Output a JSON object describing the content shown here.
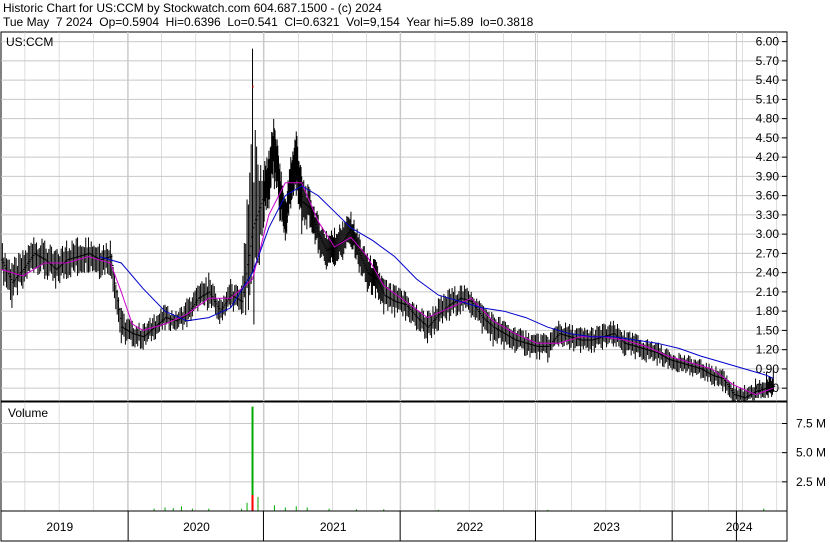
{
  "header": {
    "line1": "Historic Chart for US:CCM by Stockwatch.com 604.687.1500 - (c) 2024",
    "line2": "Tue May  7 2024  Op=0.5904  Hi=0.6396  Lo=0.541  Cl=0.6321  Vol=9,154  Year hi=5.89  lo=0.3818"
  },
  "colors": {
    "price": "#000000",
    "ma_short": "#cc00cc",
    "ma_long": "#0000cc",
    "volume": "#00aa00",
    "volume_spike": "#ff0000",
    "grid": "#c8c8c8",
    "close_marker": "#ff0000"
  },
  "chart_data": [
    {
      "type": "line",
      "panel": "price",
      "label": "US:CCM",
      "ylim": [
        0.4,
        6.15
      ],
      "yticks": [
        "6.00",
        "5.70",
        "5.40",
        "5.10",
        "4.80",
        "4.50",
        "4.20",
        "3.90",
        "3.60",
        "3.30",
        "3.00",
        "2.70",
        "2.40",
        "2.10",
        "1.80",
        "1.50",
        "1.20",
        "0.90",
        "0.60"
      ],
      "xlim": [
        2018.7,
        2024.45
      ],
      "grid": true,
      "series": [
        {
          "style": "hlc-bars",
          "x": [
            2018.7,
            2018.78,
            2018.86,
            2018.94,
            2019.02,
            2019.1,
            2019.18,
            2019.26,
            2019.34,
            2019.42,
            2019.5,
            2019.58,
            2019.66,
            2019.74,
            2019.82,
            2019.9,
            2019.98,
            2020.06,
            2020.14,
            2020.22,
            2020.3,
            2020.38,
            2020.46,
            2020.54,
            2020.62,
            2020.66,
            2020.7,
            2020.74,
            2020.78,
            2020.82,
            2020.86,
            2020.9,
            2020.96,
            2021.02,
            2021.08,
            2021.14,
            2021.2,
            2021.26,
            2021.32,
            2021.38,
            2021.44,
            2021.5,
            2021.58,
            2021.66,
            2021.74,
            2021.82,
            2021.9,
            2021.98,
            2022.06,
            2022.14,
            2022.22,
            2022.3,
            2022.38,
            2022.46,
            2022.54,
            2022.62,
            2022.7,
            2022.78,
            2022.86,
            2022.94,
            2023.02,
            2023.1,
            2023.18,
            2023.26,
            2023.34,
            2023.42,
            2023.5,
            2023.58,
            2023.66,
            2023.74,
            2023.82,
            2023.9,
            2023.98,
            2024.06,
            2024.14,
            2024.22,
            2024.3,
            2024.35
          ],
          "values": [
            2.6,
            2.25,
            2.45,
            2.7,
            2.6,
            2.45,
            2.6,
            2.65,
            2.7,
            2.6,
            2.65,
            1.55,
            1.45,
            1.4,
            1.55,
            1.7,
            1.65,
            1.75,
            2.0,
            2.1,
            1.8,
            2.05,
            1.95,
            3.1,
            3.6,
            3.9,
            4.4,
            3.7,
            3.2,
            3.8,
            4.2,
            3.5,
            3.4,
            3.0,
            2.75,
            2.8,
            2.9,
            3.1,
            2.7,
            2.4,
            2.3,
            2.05,
            1.95,
            1.9,
            1.7,
            1.55,
            1.75,
            1.9,
            2.0,
            1.95,
            1.7,
            1.55,
            1.45,
            1.35,
            1.3,
            1.25,
            1.25,
            1.45,
            1.4,
            1.35,
            1.35,
            1.4,
            1.45,
            1.3,
            1.25,
            1.2,
            1.15,
            1.05,
            1.0,
            0.95,
            0.9,
            0.8,
            0.75,
            0.5,
            0.45,
            0.55,
            0.6,
            0.63
          ],
          "high": [
            2.9,
            2.55,
            2.75,
            2.95,
            2.9,
            2.75,
            2.9,
            2.95,
            2.95,
            2.85,
            2.9,
            1.85,
            1.65,
            1.6,
            1.75,
            1.9,
            1.8,
            2.0,
            2.2,
            2.4,
            2.0,
            2.3,
            2.2,
            5.89,
            4.0,
            4.3,
            4.65,
            4.1,
            3.55,
            4.2,
            4.6,
            3.9,
            3.7,
            3.3,
            3.05,
            3.1,
            3.2,
            3.35,
            3.0,
            2.7,
            2.6,
            2.3,
            2.2,
            2.1,
            1.9,
            1.8,
            2.0,
            2.15,
            2.2,
            2.1,
            1.9,
            1.75,
            1.65,
            1.55,
            1.5,
            1.45,
            1.4,
            1.65,
            1.6,
            1.55,
            1.55,
            1.6,
            1.65,
            1.5,
            1.45,
            1.35,
            1.3,
            1.2,
            1.15,
            1.1,
            1.05,
            0.95,
            0.9,
            0.7,
            0.65,
            0.75,
            0.85,
            0.9
          ],
          "low": [
            2.3,
            1.85,
            2.15,
            2.4,
            2.3,
            2.15,
            2.3,
            2.35,
            2.4,
            2.3,
            2.35,
            1.3,
            1.25,
            1.2,
            1.35,
            1.5,
            1.5,
            1.55,
            1.8,
            1.85,
            1.6,
            1.85,
            1.75,
            2.4,
            3.1,
            3.4,
            3.7,
            3.2,
            2.9,
            3.4,
            3.6,
            3.0,
            3.1,
            2.7,
            2.45,
            2.5,
            2.6,
            2.8,
            2.4,
            2.1,
            2.0,
            1.75,
            1.7,
            1.65,
            1.5,
            1.3,
            1.5,
            1.65,
            1.75,
            1.7,
            1.45,
            1.25,
            1.2,
            1.15,
            1.1,
            1.05,
            1.0,
            1.25,
            1.2,
            1.15,
            1.15,
            1.2,
            1.25,
            1.1,
            1.05,
            1.0,
            0.95,
            0.9,
            0.85,
            0.8,
            0.75,
            0.65,
            0.55,
            0.38,
            0.4,
            0.45,
            0.5,
            0.54
          ]
        },
        {
          "style": "line",
          "colorKey": "ma_short",
          "x": [
            2018.7,
            2018.86,
            2019.02,
            2019.18,
            2019.34,
            2019.5,
            2019.58,
            2019.66,
            2019.74,
            2019.9,
            2020.06,
            2020.22,
            2020.38,
            2020.54,
            2020.66,
            2020.78,
            2020.9,
            2021.02,
            2021.14,
            2021.26,
            2021.38,
            2021.5,
            2021.66,
            2021.82,
            2021.98,
            2022.14,
            2022.3,
            2022.46,
            2022.62,
            2022.78,
            2022.94,
            2023.1,
            2023.26,
            2023.42,
            2023.58,
            2023.74,
            2023.9,
            2024.06,
            2024.22,
            2024.35
          ],
          "values": [
            2.45,
            2.35,
            2.55,
            2.55,
            2.65,
            2.55,
            2.1,
            1.6,
            1.5,
            1.6,
            1.75,
            2.0,
            2.0,
            2.3,
            3.3,
            3.8,
            3.8,
            3.2,
            2.8,
            2.95,
            2.65,
            2.2,
            1.95,
            1.7,
            1.85,
            2.0,
            1.65,
            1.45,
            1.3,
            1.3,
            1.4,
            1.4,
            1.35,
            1.25,
            1.1,
            1.0,
            0.9,
            0.65,
            0.5,
            0.6
          ]
        },
        {
          "style": "line",
          "colorKey": "ma_long",
          "x": [
            2019.42,
            2019.58,
            2019.74,
            2019.9,
            2020.06,
            2020.22,
            2020.38,
            2020.54,
            2020.66,
            2020.78,
            2020.9,
            2021.02,
            2021.14,
            2021.26,
            2021.42,
            2021.58,
            2021.74,
            2021.9,
            2022.06,
            2022.22,
            2022.38,
            2022.54,
            2022.7,
            2022.86,
            2023.02,
            2023.18,
            2023.34,
            2023.5,
            2023.66,
            2023.82,
            2023.98,
            2024.14,
            2024.3,
            2024.35
          ],
          "values": [
            2.65,
            2.55,
            2.15,
            1.8,
            1.65,
            1.7,
            1.85,
            2.4,
            3.1,
            3.6,
            3.75,
            3.6,
            3.35,
            3.1,
            2.9,
            2.65,
            2.3,
            2.05,
            1.95,
            1.85,
            1.8,
            1.7,
            1.55,
            1.45,
            1.4,
            1.4,
            1.35,
            1.3,
            1.22,
            1.1,
            1.0,
            0.9,
            0.8,
            0.75
          ]
        }
      ]
    },
    {
      "type": "bar",
      "panel": "volume",
      "label": "Volume",
      "ylim": [
        0,
        9.0
      ],
      "yticks": [
        "7.5 M",
        "5.0 M",
        "2.5 M"
      ],
      "ytick_values": [
        7.5,
        5.0,
        2.5
      ],
      "x": [
        2019.82,
        2019.9,
        2019.96,
        2020.02,
        2020.1,
        2020.22,
        2020.46,
        2020.5,
        2020.54,
        2020.58,
        2020.7,
        2020.78,
        2020.86,
        2020.94,
        2021.1,
        2021.3,
        2021.5,
        2021.9,
        2022.7,
        2024.28
      ],
      "values": [
        0.2,
        0.3,
        0.25,
        0.4,
        0.2,
        0.2,
        0.2,
        0.7,
        8.95,
        1.2,
        0.5,
        0.3,
        0.4,
        0.3,
        0.2,
        0.15,
        0.15,
        0.1,
        0.1,
        0.2
      ]
    }
  ],
  "x_axis": {
    "labels": [
      "2019",
      "2020",
      "2021",
      "2022",
      "2023",
      "2024"
    ],
    "label_values": [
      2019.13,
      2020.13,
      2021.13,
      2022.13,
      2023.13,
      2024.1
    ],
    "dividers": [
      2019.63,
      2020.62,
      2021.62,
      2022.61,
      2023.61,
      2024.08
    ]
  }
}
